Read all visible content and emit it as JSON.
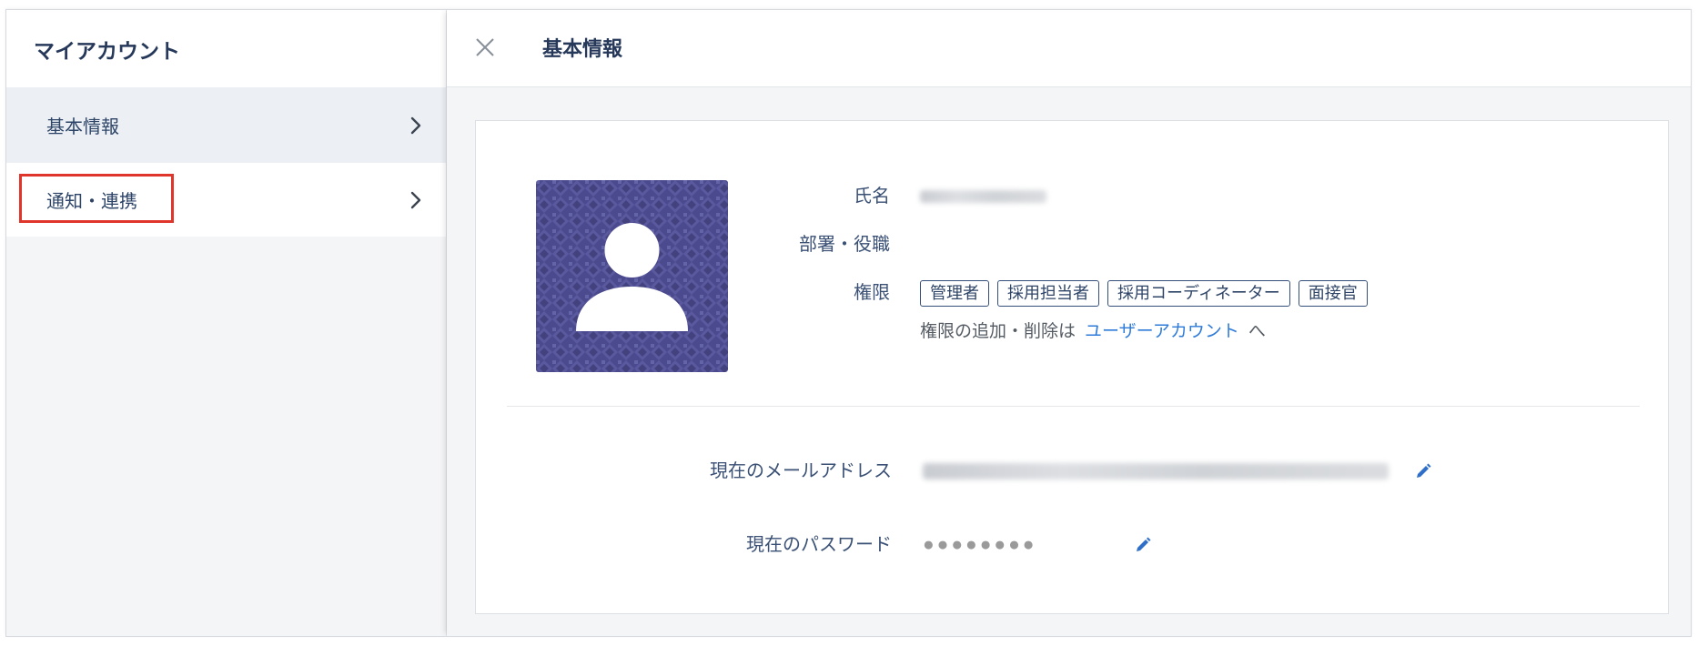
{
  "sidebar": {
    "title": "マイアカウント",
    "items": [
      {
        "label": "基本情報",
        "active": true
      },
      {
        "label": "通知・連携",
        "highlighted": true
      }
    ]
  },
  "main": {
    "title": "基本情報",
    "profile": {
      "name_label": "氏名",
      "dept_label": "部署・役職",
      "role_label": "権限",
      "roles": [
        "管理者",
        "採用担当者",
        "採用コーディネーター",
        "面接官"
      ],
      "role_note_prefix": "権限の追加・削除は",
      "role_note_link": "ユーザーアカウント",
      "role_note_suffix": "へ"
    },
    "credentials": {
      "email_label": "現在のメールアドレス",
      "password_label": "現在のパスワード",
      "password_mask": "●●●●●●●●"
    }
  },
  "icons": {
    "close": "close-icon",
    "sidebar_chevron": "chevron-right-icon",
    "edit": "pencil-icon",
    "avatar": "person-icon"
  },
  "colors": {
    "link": "#2f7bd9",
    "highlight_box": "#e0352b",
    "avatar_background": "#4b4a8f",
    "active_sidebar_item": "#ecf0f5",
    "heading_text": "#27395a"
  }
}
